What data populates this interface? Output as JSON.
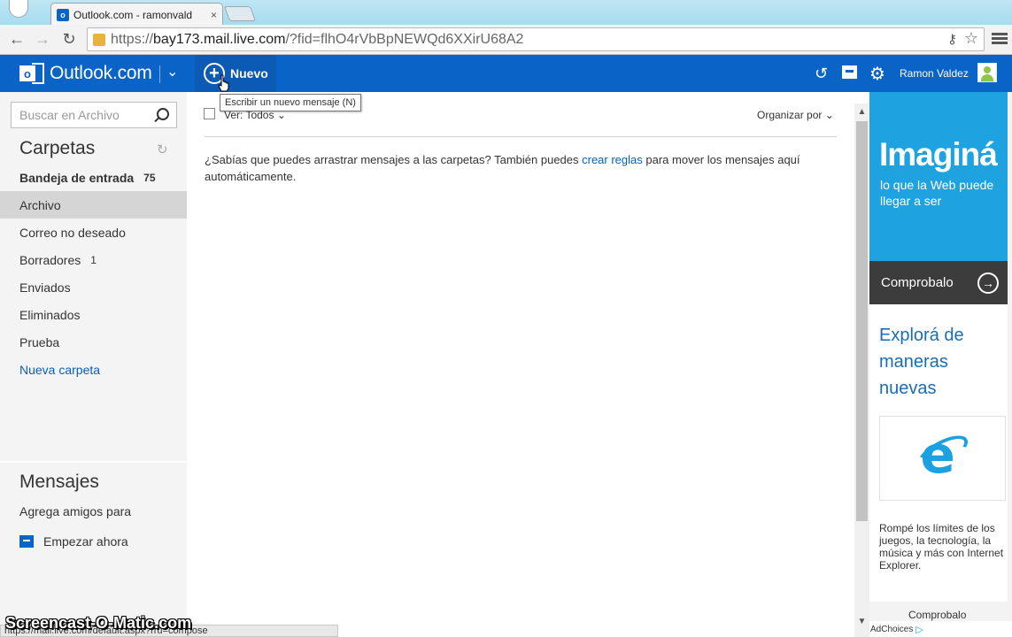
{
  "browser": {
    "tab_title": "Outlook.com - ramonvald",
    "tab_close": "×",
    "url_scheme": "https://",
    "url_host": "bay173.mail.live.com",
    "url_rest": "/?fid=flhO4rVbBpNEWQd6XXirU68A2",
    "status_url": "https://mail.live.com/default.aspx?rru=compose",
    "favicon": "o",
    "back": "←",
    "forward": "→",
    "reload": "↻",
    "key": "⚷",
    "star": "☆"
  },
  "appbar": {
    "brand": "Outlook.com",
    "brand_logo_letter": "o",
    "brand_chevron": "⌄",
    "new_label": "Nuevo",
    "new_glyph": "+",
    "undo": "↺",
    "gear": "⚙",
    "user_name": "Ramon Valdez",
    "tooltip": "Escribir un nuevo mensaje (N)"
  },
  "sidebar": {
    "search_placeholder": "Buscar en Archivo",
    "folders_title": "Carpetas",
    "refresh": "↻",
    "folders": [
      {
        "label": "Bandeja de entrada",
        "count": "75"
      },
      {
        "label": "Archivo",
        "count": ""
      },
      {
        "label": "Correo no deseado",
        "count": ""
      },
      {
        "label": "Borradores",
        "count": "1"
      },
      {
        "label": "Enviados",
        "count": ""
      },
      {
        "label": "Eliminados",
        "count": ""
      },
      {
        "label": "Prueba",
        "count": ""
      },
      {
        "label": "Nueva carpeta",
        "count": ""
      }
    ],
    "messages_title": "Mensajes",
    "messages_text": "Agrega amigos para",
    "start_now": "Empezar ahora"
  },
  "main": {
    "view_filter": "Ver: Todos ⌄",
    "organize": "Organizar por ⌄",
    "hint_before": "¿Sabías que puedes arrastrar mensajes a las carpetas? También puedes ",
    "hint_link": "crear reglas",
    "hint_after": " para mover los mensajes aquí automáticamente."
  },
  "scrollbar": {
    "up": "▲",
    "down": "▼"
  },
  "ads": {
    "hero_title": "Imaginá",
    "hero_sub": "lo que la Web puede llegar a ser",
    "hero_button": "Comprobalo",
    "hero_arrow": "→",
    "card_title": "Explorá de maneras nuevas",
    "card_desc": "Rompé los límites de los juegos, la tecnología, la música y más con Internet Explorer.",
    "more_button": "Comprobalo",
    "adchoices": "AdChoices",
    "adchoices_icon": "▷"
  },
  "overlay": {
    "watermark": "Screencast-O-Matic.com"
  },
  "colors": {
    "appbar": "#0a63c6",
    "accent_link": "#0a5fb5",
    "ad_blue": "#1fa3e0"
  }
}
